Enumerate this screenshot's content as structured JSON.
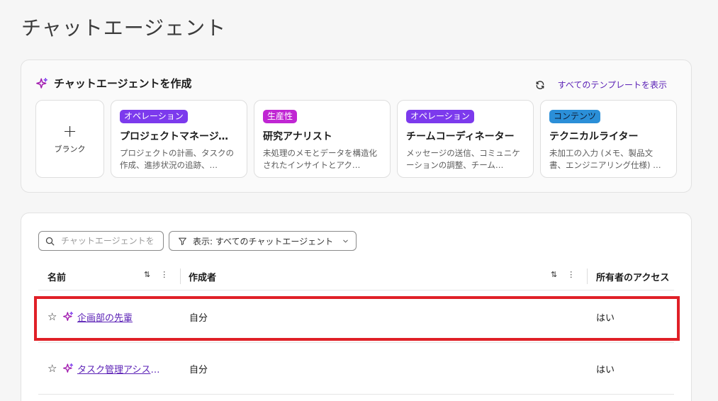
{
  "page": {
    "title": "チャットエージェント"
  },
  "create_section": {
    "title": "チャットエージェントを作成",
    "show_all_label": "すべてのテンプレートを表示",
    "blank_label": "ブランク",
    "templates": [
      {
        "badge": "オペレーション",
        "name": "プロジェクトマネージャー",
        "desc": "プロジェクトの計画、タスクの作成、進捗状況の追跡、…"
      },
      {
        "badge": "生産性",
        "name": "研究アナリスト",
        "desc": "未処理のメモとデータを構造化されたインサイトとアク…"
      },
      {
        "badge": "オペレーション",
        "name": "チームコーディネーター",
        "desc": "メッセージの送信、コミュニケーションの調整、チーム…"
      },
      {
        "badge": "コンテンツ",
        "name": "テクニカルライター",
        "desc": "未加工の入力 (メモ、製品文書、エンジニアリング仕様) …"
      }
    ]
  },
  "list": {
    "search_placeholder": "チャットエージェントを",
    "filter_label": "表示: すべてのチャットエージェント",
    "columns": {
      "name": "名前",
      "creator": "作成者",
      "access": "所有者のアクセス"
    },
    "rows": [
      {
        "name": "企画部の先輩",
        "creator": "自分",
        "access": "はい"
      },
      {
        "name": "タスク管理アシスタント",
        "creator": "自分",
        "access": "はい"
      }
    ]
  },
  "colors": {
    "accent": "#5b21b6",
    "ops": "#7c3aed",
    "productivity": "#c026d3",
    "content": "#2b8fd8",
    "highlight": "#e02027"
  }
}
